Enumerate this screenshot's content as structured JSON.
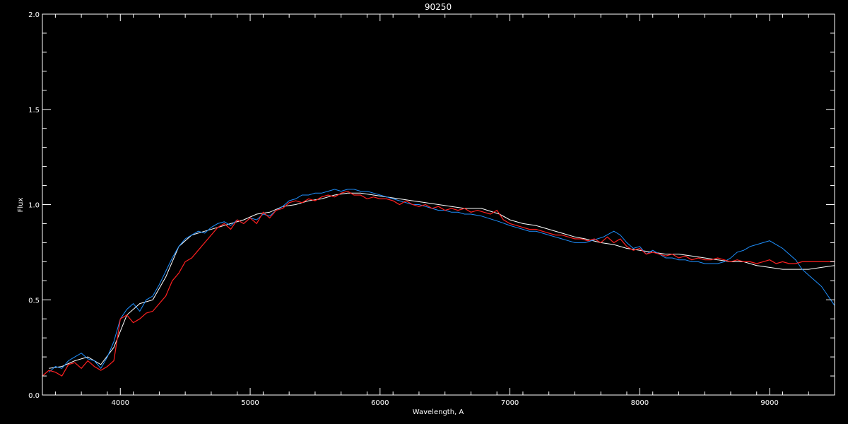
{
  "chart_data": {
    "type": "line",
    "title": "90250",
    "xlabel": "Wavelength, A",
    "ylabel": "Flux",
    "xlim": [
      3400,
      9500
    ],
    "ylim": [
      0.0,
      2.0
    ],
    "x_ticks": [
      4000,
      5000,
      6000,
      7000,
      8000,
      9000
    ],
    "x_tick_labels": [
      "4000",
      "5000",
      "6000",
      "7000",
      "8000",
      "9000"
    ],
    "y_ticks": [
      0.0,
      0.5,
      1.0,
      1.5,
      2.0
    ],
    "y_tick_labels": [
      "0.0",
      "0.5",
      "1.0",
      "1.5",
      "2.0"
    ],
    "grid": false,
    "series": [
      {
        "color": "#ffffff",
        "points": [
          [
            3450,
            0.14
          ],
          [
            3550,
            0.15
          ],
          [
            3650,
            0.18
          ],
          [
            3750,
            0.2
          ],
          [
            3850,
            0.16
          ],
          [
            3950,
            0.25
          ],
          [
            4050,
            0.42
          ],
          [
            4150,
            0.48
          ],
          [
            4250,
            0.5
          ],
          [
            4350,
            0.62
          ],
          [
            4450,
            0.78
          ],
          [
            4550,
            0.84
          ],
          [
            4650,
            0.86
          ],
          [
            4750,
            0.88
          ],
          [
            4850,
            0.9
          ],
          [
            4950,
            0.92
          ],
          [
            5050,
            0.95
          ],
          [
            5150,
            0.96
          ],
          [
            5250,
            0.99
          ],
          [
            5350,
            1.0
          ],
          [
            5450,
            1.02
          ],
          [
            5550,
            1.03
          ],
          [
            5650,
            1.05
          ],
          [
            5750,
            1.06
          ],
          [
            5850,
            1.06
          ],
          [
            5950,
            1.05
          ],
          [
            6050,
            1.04
          ],
          [
            6150,
            1.03
          ],
          [
            6250,
            1.02
          ],
          [
            6350,
            1.01
          ],
          [
            6450,
            1.0
          ],
          [
            6550,
            0.99
          ],
          [
            6650,
            0.98
          ],
          [
            6780,
            0.98
          ],
          [
            6920,
            0.95
          ],
          [
            7000,
            0.92
          ],
          [
            7100,
            0.9
          ],
          [
            7200,
            0.89
          ],
          [
            7300,
            0.87
          ],
          [
            7400,
            0.85
          ],
          [
            7500,
            0.83
          ],
          [
            7580,
            0.82
          ],
          [
            7700,
            0.8
          ],
          [
            7800,
            0.79
          ],
          [
            7900,
            0.77
          ],
          [
            8000,
            0.76
          ],
          [
            8100,
            0.75
          ],
          [
            8200,
            0.74
          ],
          [
            8300,
            0.74
          ],
          [
            8400,
            0.73
          ],
          [
            8500,
            0.72
          ],
          [
            8600,
            0.71
          ],
          [
            8700,
            0.7
          ],
          [
            8800,
            0.7
          ],
          [
            8900,
            0.68
          ],
          [
            9000,
            0.67
          ],
          [
            9100,
            0.66
          ],
          [
            9200,
            0.66
          ],
          [
            9300,
            0.66
          ],
          [
            9400,
            0.67
          ],
          [
            9500,
            0.68
          ]
        ]
      },
      {
        "color": "#1e90ff",
        "points": [
          [
            3450,
            0.12
          ],
          [
            3500,
            0.15
          ],
          [
            3550,
            0.14
          ],
          [
            3600,
            0.18
          ],
          [
            3650,
            0.2
          ],
          [
            3700,
            0.22
          ],
          [
            3750,
            0.19
          ],
          [
            3800,
            0.18
          ],
          [
            3850,
            0.14
          ],
          [
            3900,
            0.2
          ],
          [
            3950,
            0.28
          ],
          [
            4000,
            0.4
          ],
          [
            4050,
            0.45
          ],
          [
            4100,
            0.48
          ],
          [
            4150,
            0.44
          ],
          [
            4200,
            0.5
          ],
          [
            4250,
            0.52
          ],
          [
            4300,
            0.58
          ],
          [
            4350,
            0.65
          ],
          [
            4400,
            0.72
          ],
          [
            4450,
            0.78
          ],
          [
            4500,
            0.82
          ],
          [
            4550,
            0.84
          ],
          [
            4600,
            0.86
          ],
          [
            4650,
            0.85
          ],
          [
            4700,
            0.88
          ],
          [
            4750,
            0.9
          ],
          [
            4800,
            0.91
          ],
          [
            4850,
            0.89
          ],
          [
            4900,
            0.92
          ],
          [
            4950,
            0.9
          ],
          [
            5000,
            0.93
          ],
          [
            5050,
            0.92
          ],
          [
            5100,
            0.95
          ],
          [
            5150,
            0.94
          ],
          [
            5200,
            0.97
          ],
          [
            5250,
            0.99
          ],
          [
            5300,
            1.02
          ],
          [
            5350,
            1.03
          ],
          [
            5400,
            1.05
          ],
          [
            5450,
            1.05
          ],
          [
            5500,
            1.06
          ],
          [
            5550,
            1.06
          ],
          [
            5600,
            1.07
          ],
          [
            5650,
            1.08
          ],
          [
            5700,
            1.07
          ],
          [
            5750,
            1.08
          ],
          [
            5800,
            1.08
          ],
          [
            5850,
            1.07
          ],
          [
            5900,
            1.07
          ],
          [
            5950,
            1.06
          ],
          [
            6000,
            1.05
          ],
          [
            6050,
            1.04
          ],
          [
            6100,
            1.03
          ],
          [
            6150,
            1.02
          ],
          [
            6200,
            1.01
          ],
          [
            6250,
            1.0
          ],
          [
            6300,
            1.0
          ],
          [
            6350,
            0.99
          ],
          [
            6400,
            0.98
          ],
          [
            6450,
            0.97
          ],
          [
            6500,
            0.97
          ],
          [
            6550,
            0.96
          ],
          [
            6600,
            0.96
          ],
          [
            6650,
            0.95
          ],
          [
            6700,
            0.95
          ],
          [
            6780,
            0.94
          ],
          [
            6920,
            0.91
          ],
          [
            7000,
            0.89
          ],
          [
            7050,
            0.88
          ],
          [
            7100,
            0.87
          ],
          [
            7150,
            0.86
          ],
          [
            7200,
            0.86
          ],
          [
            7250,
            0.85
          ],
          [
            7300,
            0.84
          ],
          [
            7350,
            0.83
          ],
          [
            7400,
            0.82
          ],
          [
            7450,
            0.81
          ],
          [
            7500,
            0.8
          ],
          [
            7580,
            0.8
          ],
          [
            7720,
            0.83
          ],
          [
            7800,
            0.86
          ],
          [
            7850,
            0.84
          ],
          [
            7900,
            0.8
          ],
          [
            7950,
            0.77
          ],
          [
            8000,
            0.78
          ],
          [
            8050,
            0.74
          ],
          [
            8100,
            0.76
          ],
          [
            8150,
            0.74
          ],
          [
            8200,
            0.72
          ],
          [
            8250,
            0.72
          ],
          [
            8300,
            0.71
          ],
          [
            8350,
            0.71
          ],
          [
            8400,
            0.7
          ],
          [
            8450,
            0.7
          ],
          [
            8500,
            0.69
          ],
          [
            8550,
            0.69
          ],
          [
            8600,
            0.69
          ],
          [
            8650,
            0.7
          ],
          [
            8700,
            0.72
          ],
          [
            8750,
            0.75
          ],
          [
            8800,
            0.76
          ],
          [
            8850,
            0.78
          ],
          [
            8900,
            0.79
          ],
          [
            8950,
            0.8
          ],
          [
            9000,
            0.81
          ],
          [
            9050,
            0.79
          ],
          [
            9100,
            0.77
          ],
          [
            9150,
            0.74
          ],
          [
            9200,
            0.71
          ],
          [
            9250,
            0.66
          ],
          [
            9300,
            0.63
          ],
          [
            9350,
            0.6
          ],
          [
            9400,
            0.57
          ],
          [
            9450,
            0.52
          ],
          [
            9500,
            0.47
          ]
        ]
      },
      {
        "color": "#ff2020",
        "points": [
          [
            3400,
            0.1
          ],
          [
            3450,
            0.13
          ],
          [
            3500,
            0.12
          ],
          [
            3550,
            0.1
          ],
          [
            3600,
            0.16
          ],
          [
            3650,
            0.17
          ],
          [
            3700,
            0.14
          ],
          [
            3750,
            0.18
          ],
          [
            3800,
            0.15
          ],
          [
            3850,
            0.13
          ],
          [
            3900,
            0.15
          ],
          [
            3950,
            0.18
          ],
          [
            4000,
            0.4
          ],
          [
            4050,
            0.42
          ],
          [
            4100,
            0.38
          ],
          [
            4150,
            0.4
          ],
          [
            4200,
            0.43
          ],
          [
            4250,
            0.44
          ],
          [
            4300,
            0.48
          ],
          [
            4350,
            0.52
          ],
          [
            4400,
            0.6
          ],
          [
            4450,
            0.64
          ],
          [
            4500,
            0.7
          ],
          [
            4550,
            0.72
          ],
          [
            4600,
            0.76
          ],
          [
            4650,
            0.8
          ],
          [
            4700,
            0.84
          ],
          [
            4750,
            0.88
          ],
          [
            4800,
            0.9
          ],
          [
            4850,
            0.87
          ],
          [
            4900,
            0.92
          ],
          [
            4950,
            0.9
          ],
          [
            5000,
            0.93
          ],
          [
            5050,
            0.9
          ],
          [
            5100,
            0.96
          ],
          [
            5150,
            0.93
          ],
          [
            5200,
            0.97
          ],
          [
            5250,
            0.98
          ],
          [
            5300,
            1.01
          ],
          [
            5350,
            1.02
          ],
          [
            5400,
            1.01
          ],
          [
            5450,
            1.03
          ],
          [
            5500,
            1.02
          ],
          [
            5550,
            1.04
          ],
          [
            5600,
            1.05
          ],
          [
            5650,
            1.04
          ],
          [
            5700,
            1.06
          ],
          [
            5750,
            1.07
          ],
          [
            5800,
            1.05
          ],
          [
            5850,
            1.05
          ],
          [
            5900,
            1.03
          ],
          [
            5950,
            1.04
          ],
          [
            6000,
            1.03
          ],
          [
            6050,
            1.03
          ],
          [
            6100,
            1.02
          ],
          [
            6150,
            1.0
          ],
          [
            6200,
            1.02
          ],
          [
            6250,
            1.0
          ],
          [
            6300,
            0.99
          ],
          [
            6350,
            1.0
          ],
          [
            6400,
            0.98
          ],
          [
            6450,
            0.99
          ],
          [
            6500,
            0.97
          ],
          [
            6550,
            0.98
          ],
          [
            6600,
            0.97
          ],
          [
            6650,
            0.98
          ],
          [
            6700,
            0.96
          ],
          [
            6750,
            0.97
          ],
          [
            6800,
            0.96
          ],
          [
            6850,
            0.95
          ],
          [
            6900,
            0.97
          ],
          [
            6950,
            0.92
          ],
          [
            7000,
            0.9
          ],
          [
            7050,
            0.89
          ],
          [
            7100,
            0.88
          ],
          [
            7150,
            0.87
          ],
          [
            7200,
            0.87
          ],
          [
            7250,
            0.86
          ],
          [
            7300,
            0.85
          ],
          [
            7350,
            0.84
          ],
          [
            7400,
            0.84
          ],
          [
            7450,
            0.83
          ],
          [
            7500,
            0.82
          ],
          [
            7550,
            0.82
          ],
          [
            7600,
            0.81
          ],
          [
            7650,
            0.82
          ],
          [
            7700,
            0.8
          ],
          [
            7750,
            0.83
          ],
          [
            7800,
            0.8
          ],
          [
            7850,
            0.82
          ],
          [
            7900,
            0.78
          ],
          [
            7950,
            0.76
          ],
          [
            8000,
            0.77
          ],
          [
            8050,
            0.74
          ],
          [
            8100,
            0.75
          ],
          [
            8150,
            0.74
          ],
          [
            8200,
            0.73
          ],
          [
            8250,
            0.74
          ],
          [
            8300,
            0.72
          ],
          [
            8350,
            0.73
          ],
          [
            8400,
            0.71
          ],
          [
            8450,
            0.72
          ],
          [
            8500,
            0.71
          ],
          [
            8550,
            0.71
          ],
          [
            8600,
            0.72
          ],
          [
            8650,
            0.71
          ],
          [
            8700,
            0.7
          ],
          [
            8750,
            0.71
          ],
          [
            8800,
            0.7
          ],
          [
            8850,
            0.7
          ],
          [
            8900,
            0.69
          ],
          [
            8950,
            0.7
          ],
          [
            9000,
            0.71
          ],
          [
            9050,
            0.69
          ],
          [
            9100,
            0.7
          ],
          [
            9150,
            0.69
          ],
          [
            9200,
            0.69
          ],
          [
            9250,
            0.7
          ],
          [
            9300,
            0.7
          ],
          [
            9350,
            0.7
          ],
          [
            9400,
            0.7
          ],
          [
            9450,
            0.7
          ],
          [
            9500,
            0.7
          ]
        ]
      }
    ]
  }
}
